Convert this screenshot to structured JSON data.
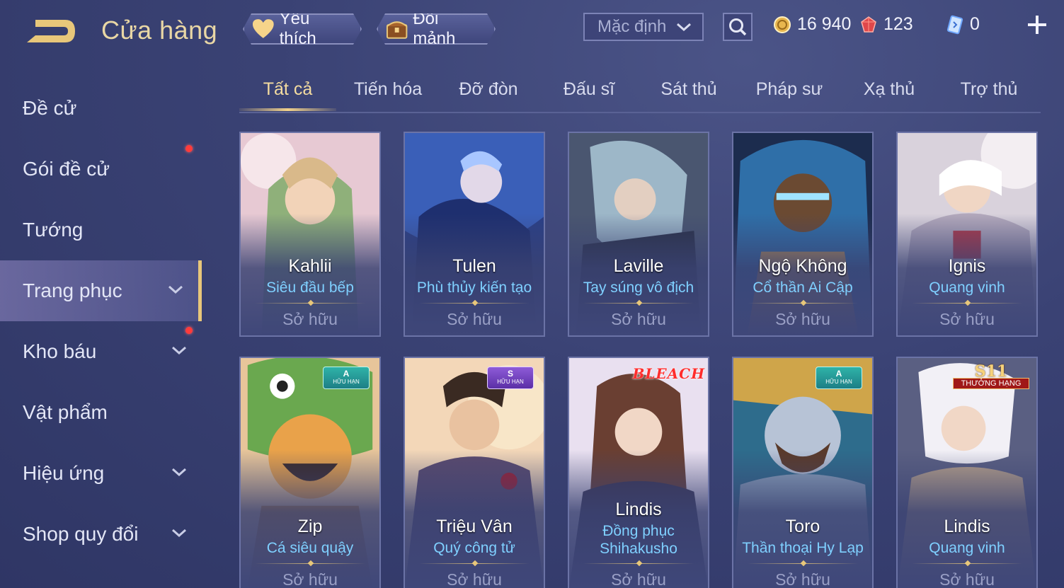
{
  "header": {
    "title": "Cửa hàng",
    "favorites_label": "Yêu thích",
    "exchange_label": "Đổi mảnh",
    "sort": {
      "selected": "Mặc định"
    },
    "currencies": {
      "gold": "16 940",
      "ruby": "123",
      "voucher": "0"
    }
  },
  "sidebar": {
    "items": [
      {
        "label": "Đề cử"
      },
      {
        "label": "Gói đề cử"
      },
      {
        "label": "Tướng"
      },
      {
        "label": "Trang phục"
      },
      {
        "label": "Kho báu"
      },
      {
        "label": "Vật phẩm"
      },
      {
        "label": "Hiệu ứng"
      },
      {
        "label": "Shop quy đổi"
      }
    ]
  },
  "tabs": [
    "Tất cả",
    "Tiến hóa",
    "Đỡ đòn",
    "Đấu sĩ",
    "Sát thủ",
    "Pháp sư",
    "Xạ thủ",
    "Trợ thủ"
  ],
  "cards": [
    {
      "hero": "Kahlii",
      "skin": "Siêu đầu bếp",
      "status": "Sở hữu",
      "palette": [
        "#f3dfe2",
        "#8fb07a",
        "#d9b98a"
      ]
    },
    {
      "hero": "Tulen",
      "skin": "Phù thủy kiến tạo",
      "status": "Sở hữu",
      "palette": [
        "#3a5fb8",
        "#1e2f6f",
        "#a8c6ff"
      ]
    },
    {
      "hero": "Laville",
      "skin": "Tay súng vô địch",
      "status": "Sở hữu",
      "palette": [
        "#5a6b86",
        "#2a3146",
        "#9db7c8"
      ]
    },
    {
      "hero": "Ngộ Không",
      "skin": "Cổ thần Ai Cập",
      "status": "Sở hữu",
      "palette": [
        "#2f6fa8",
        "#1c2c4e",
        "#c89a4e"
      ]
    },
    {
      "hero": "Ignis",
      "skin": "Quang vinh",
      "status": "Sở hữu",
      "palette": [
        "#e7e2e6",
        "#b3a9bc",
        "#d9c4a0"
      ]
    },
    {
      "hero": "Zip",
      "skin": "Cá siêu quậy",
      "status": "Sở hữu",
      "badge": "A",
      "badge_sub": "HỮU HẠN",
      "palette": [
        "#6aa84f",
        "#e9a24a",
        "#f1d9a6"
      ]
    },
    {
      "hero": "Triệu Vân",
      "skin": "Quý công tử",
      "status": "Sở hữu",
      "badge": "S",
      "badge_sub": "HỮU HẠN",
      "palette": [
        "#f3d7b8",
        "#5a4a6e",
        "#e8c77a"
      ]
    },
    {
      "hero": "Lindis",
      "skin": "Đồng phục Shihakusho",
      "status": "Sở hữu",
      "badge": "BLEACH",
      "palette": [
        "#e9e0f0",
        "#6a5b78",
        "#b8a4c7"
      ]
    },
    {
      "hero": "Toro",
      "skin": "Thần thoại Hy Lạp",
      "status": "Sở hữu",
      "badge": "A",
      "badge_sub": "HỮU HẠN",
      "palette": [
        "#b7c3d6",
        "#2e6c8c",
        "#cfa54a"
      ]
    },
    {
      "hero": "Lindis",
      "skin": "Quang vinh",
      "status": "Sở hữu",
      "badge": "S11",
      "badge_sub": "THƯỞNG HẠNG",
      "palette": [
        "#dcd6e6",
        "#5a5f82",
        "#b9a28a"
      ]
    }
  ],
  "colors": {
    "accent_gold": "#e8c77a",
    "skin_name_blue": "#7fd0ff",
    "notification_red": "#ff3b3b"
  }
}
